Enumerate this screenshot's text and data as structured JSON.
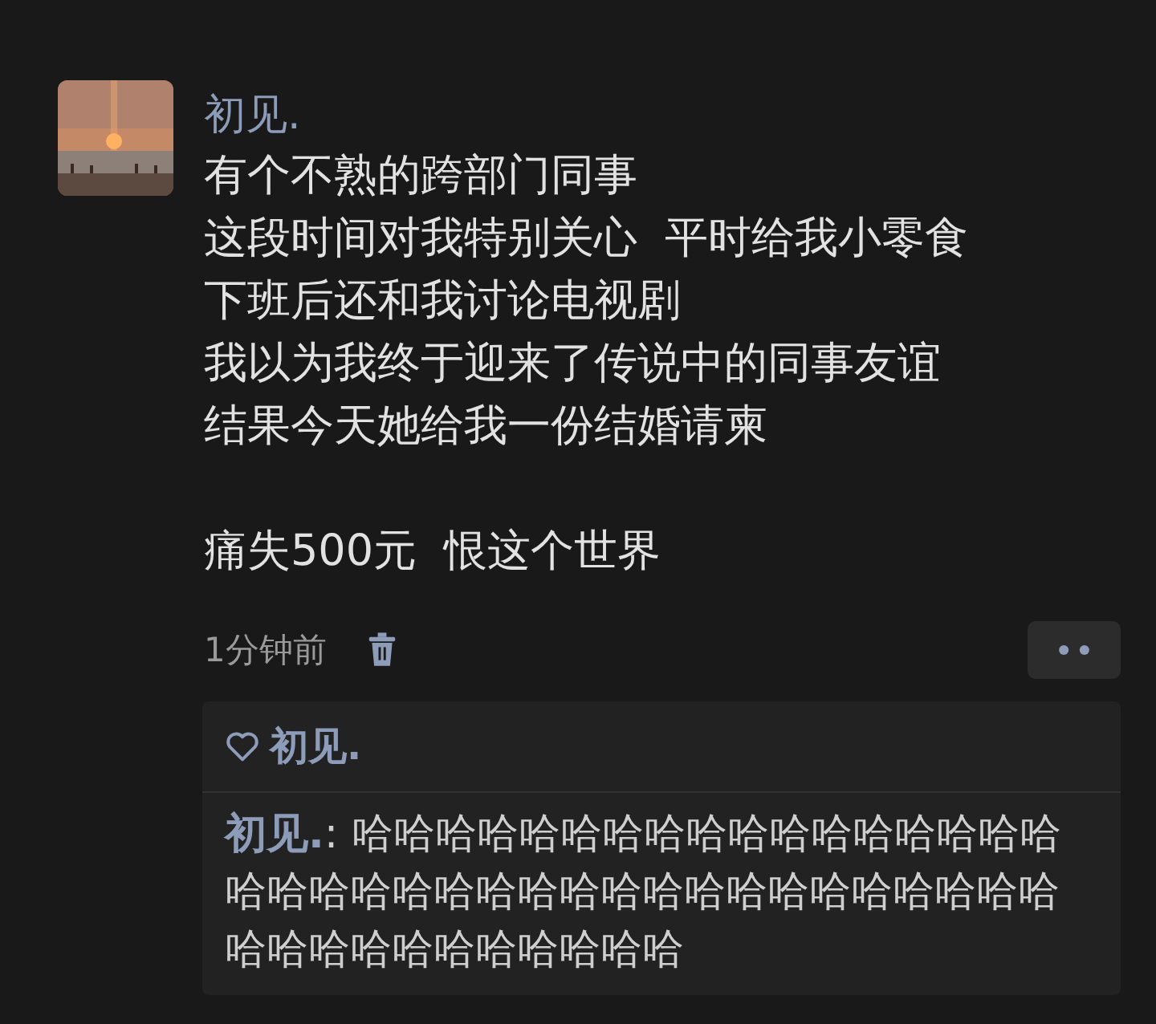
{
  "post": {
    "author": "初见.",
    "paragraphs": [
      [
        "有个不熟的跨部门同事",
        "这段时间对我特别关心  平时给我小零食",
        "下班后还和我讨论电视剧",
        "我以为我终于迎来了传说中的同事友谊",
        "结果今天她给我一份结婚请柬"
      ],
      [
        "痛失500元  恨这个世界"
      ]
    ],
    "time": "1分钟前"
  },
  "likes": {
    "names": [
      "初见."
    ]
  },
  "comments": [
    {
      "author": "初见.",
      "text": ": 哈哈哈哈哈哈哈哈哈哈哈哈哈哈哈哈哈哈哈哈哈哈哈哈哈哈哈哈哈哈哈哈哈哈哈哈哈哈哈哈哈哈哈哈哈哈哈哈"
    }
  ]
}
